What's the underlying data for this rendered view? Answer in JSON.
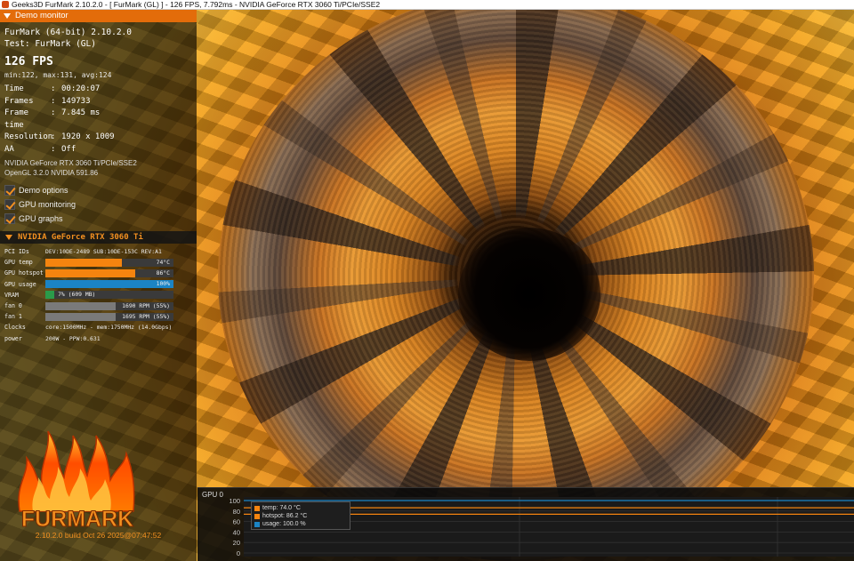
{
  "window": {
    "title": "Geeks3D FurMark 2.10.2.0 - [ FurMark (GL) ] - 126 FPS, 7.792ms - NVIDIA GeForce RTX 3060 Ti/PCIe/SSE2"
  },
  "panel": {
    "header": "Demo monitor",
    "app": "FurMark (64-bit) 2.10.2.0",
    "test": "Test: FurMark (GL)",
    "fps": "126 FPS",
    "fps_stats": "min:122, max:131, avg:124",
    "stats": [
      {
        "label": "Time",
        "value": "00:20:07"
      },
      {
        "label": "Frames",
        "value": "149733"
      },
      {
        "label": "Frame time",
        "value": "7.845 ms"
      },
      {
        "label": "Resolution",
        "value": "1920 x 1009"
      },
      {
        "label": "AA",
        "value": "Off"
      }
    ],
    "renderer": "NVIDIA GeForce RTX 3060 Ti/PCIe/SSE2",
    "gl": "OpenGL 3.2.0 NVIDIA 591.86",
    "options": [
      {
        "label": "Demo options",
        "checked": true
      },
      {
        "label": "GPU monitoring",
        "checked": true
      },
      {
        "label": "GPU graphs",
        "checked": true
      }
    ]
  },
  "gpu": {
    "header": "NVIDIA GeForce RTX 3060 Ti",
    "pci": {
      "label": "PCI IDs",
      "value": "DEV:10DE-2489 SUB:10DE-153C REV:A1"
    },
    "bars": [
      {
        "label": "GPU temp",
        "text": "74°C",
        "fraction": 0.6,
        "color": "#f5840f"
      },
      {
        "label": "GPU hotspot",
        "text": "86°C",
        "fraction": 0.7,
        "color": "#f5840f"
      },
      {
        "label": "GPU usage",
        "text": "100%",
        "fraction": 1.0,
        "color": "#1b84c5"
      },
      {
        "label": "VRAM",
        "text": "7% (609 MB)",
        "fraction": 0.07,
        "color": "#2b9b4a"
      },
      {
        "label": "fan 0",
        "text": "1690 RPM (55%)",
        "fraction": 0.55,
        "color": "#7a7a7a"
      },
      {
        "label": "fan 1",
        "text": "1695 RPM (55%)",
        "fraction": 0.55,
        "color": "#7a7a7a"
      }
    ],
    "clocks": {
      "label": "Clocks",
      "value": "core:1500MHz - mem:1750MHz (14.0Gbps)"
    },
    "power": {
      "label": "power",
      "value": "200W - PPW:0.631"
    }
  },
  "logo": {
    "text": "FURMARK",
    "color": "#f39020"
  },
  "build": "2.10.2.0 build Oct 26 2025@07:47:52",
  "graph": {
    "title": "GPU 0",
    "yticks": [
      "100",
      "80",
      "60",
      "40",
      "20",
      "0"
    ],
    "legend": [
      {
        "label": "temp: 74.0 °C",
        "color": "#f5840f"
      },
      {
        "label": "hotspot: 86.2 °C",
        "color": "#f5840f"
      },
      {
        "label": "usage: 100.0 %",
        "color": "#1b84c5"
      }
    ],
    "series": {
      "temp": 74.0,
      "hotspot": 86.2,
      "usage": 100.0
    }
  }
}
